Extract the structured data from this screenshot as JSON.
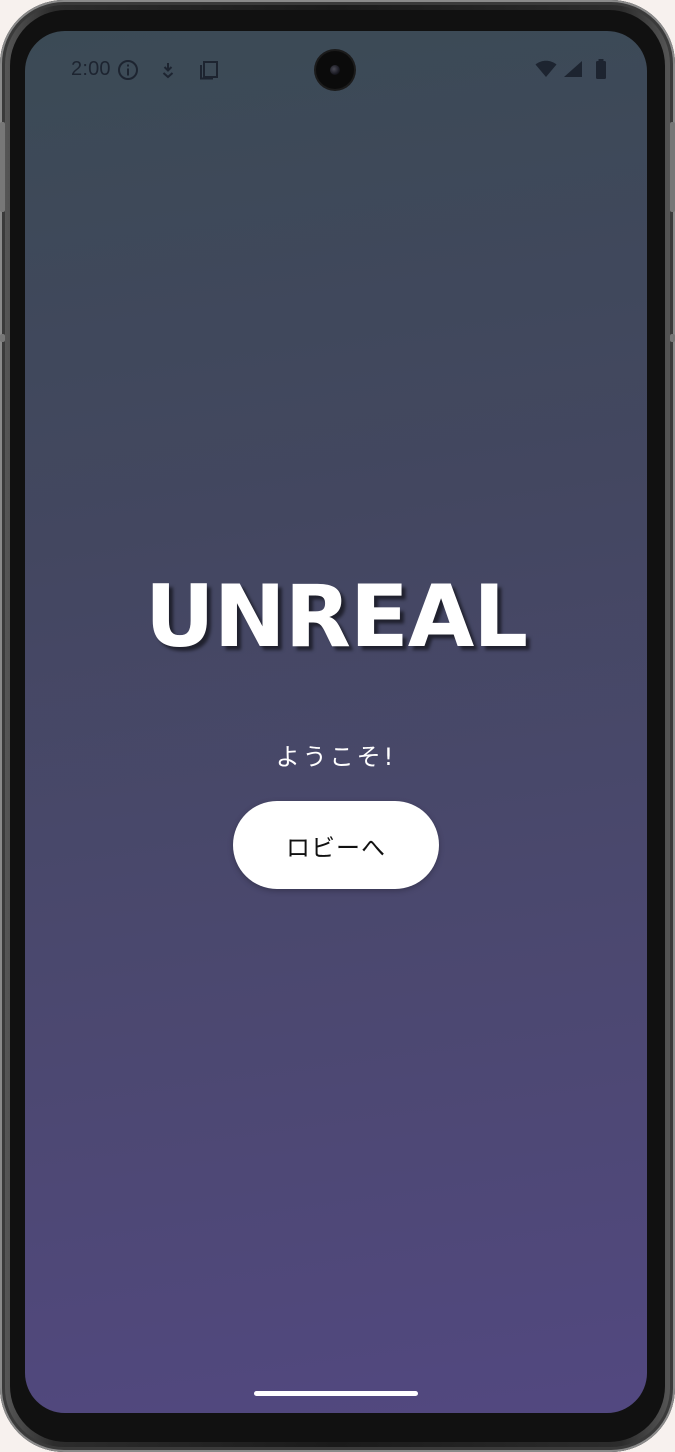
{
  "status_bar": {
    "time": "2:00",
    "left_icons": [
      "info-icon",
      "download-icon",
      "clipboard-icon"
    ],
    "right_icons": [
      "wifi-icon",
      "cellular-icon",
      "battery-icon"
    ]
  },
  "app": {
    "title": "UNREAL",
    "welcome": "ようこそ!",
    "lobby_button_label": "ロビーへ"
  },
  "colors": {
    "background_top": "#3b4a55",
    "background_bottom": "#524880",
    "button_background": "#ffffff",
    "title_color": "#ffffff"
  }
}
